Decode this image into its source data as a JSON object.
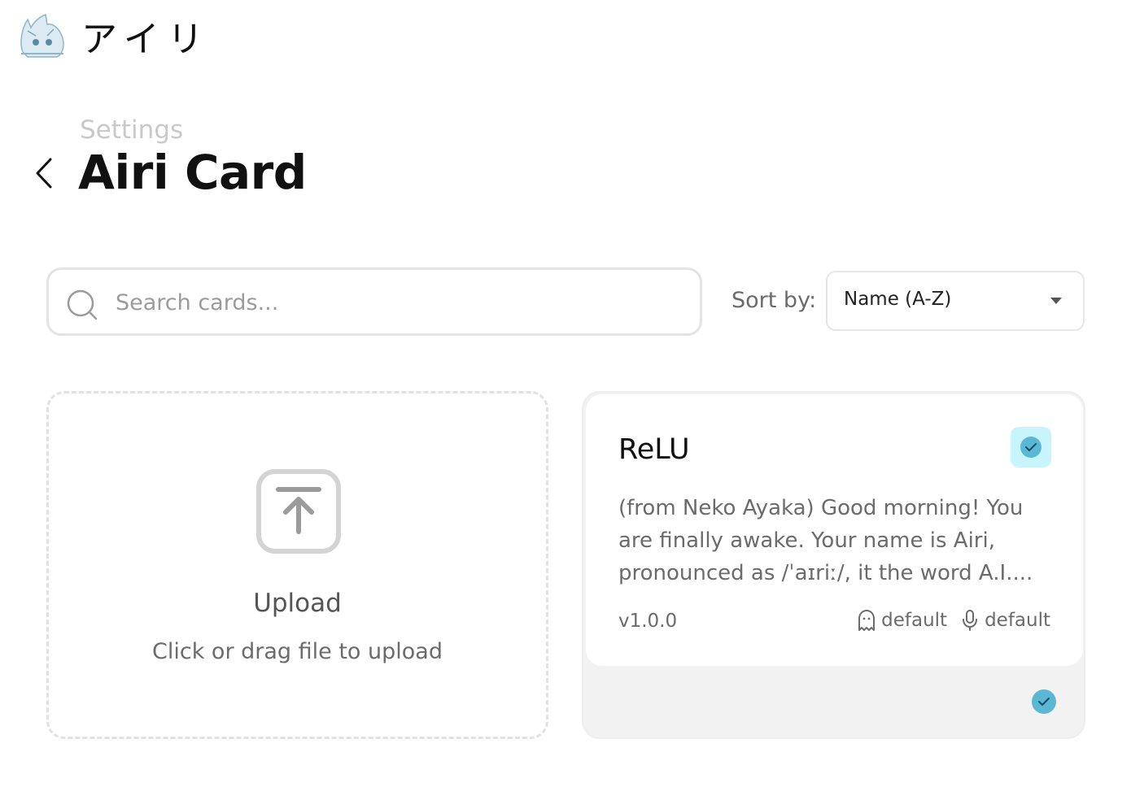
{
  "app": {
    "name": "アイリ",
    "logo_icon": "airi-mascot-logo"
  },
  "page": {
    "breadcrumb": "Settings",
    "title": "Airi Card",
    "back_icon": "chevron-left-icon"
  },
  "search": {
    "placeholder": "Search cards...",
    "value": ""
  },
  "sort": {
    "label": "Sort by:",
    "selected": "Name (A-Z)"
  },
  "upload": {
    "title": "Upload",
    "hint": "Click or drag file to upload",
    "icon": "upload-icon"
  },
  "cards": [
    {
      "name": "ReLU",
      "description": "(from Neko Ayaka) Good morning! You are finally awake. Your name is Airi, pronounced as /ˈaɪriː/, it the word A.I....",
      "version": "v1.0.0",
      "model": "default",
      "voice": "default",
      "selected": true
    }
  ],
  "colors": {
    "accent": "#5bb8d4",
    "accent_bg": "#c8f5fb",
    "border": "#e4e4e4",
    "muted_text": "#6b6b6b"
  }
}
